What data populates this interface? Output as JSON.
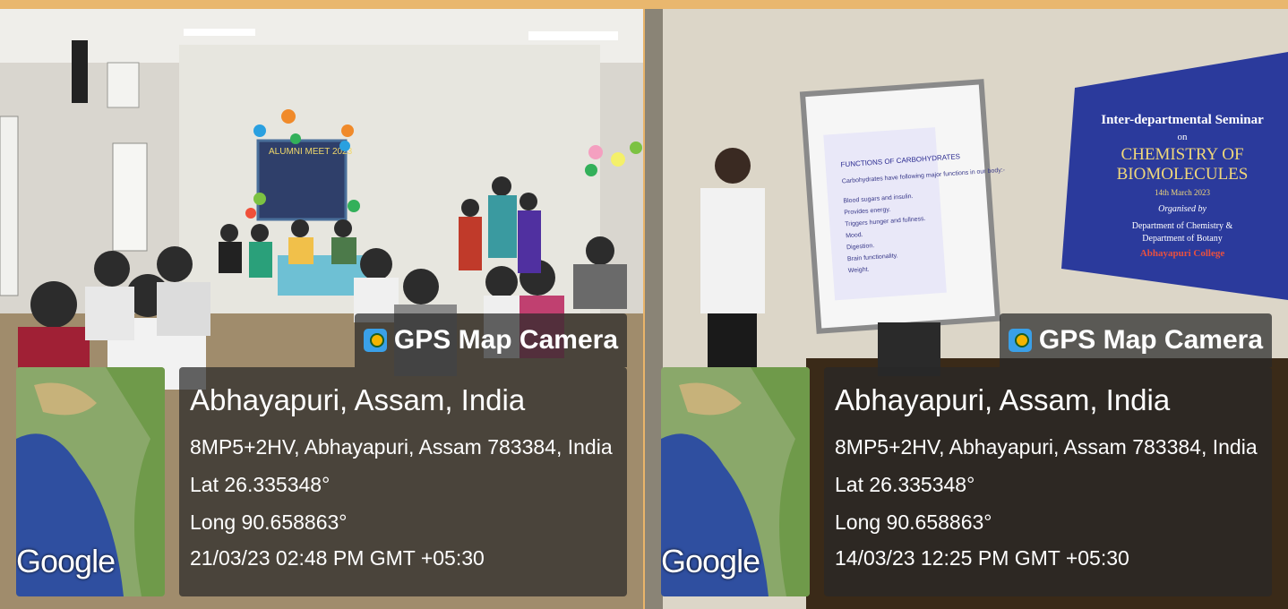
{
  "left_photo": {
    "stamp": {
      "app": "GPS Map Camera",
      "place": "Abhayapuri, Assam, India",
      "address": "8MP5+2HV, Abhayapuri, Assam 783384, India",
      "lat": "Lat 26.335348°",
      "long": "Long 90.658863°",
      "datetime": "21/03/23 02:48 PM GMT +05:30",
      "map_brand": "Google"
    },
    "banner": "ALUMNI MEET 2023"
  },
  "right_photo": {
    "stamp": {
      "app": "GPS Map Camera",
      "place": "Abhayapuri, Assam, India",
      "address": "8MP5+2HV, Abhayapuri, Assam 783384, India",
      "lat": "Lat 26.335348°",
      "long": "Long 90.658863°",
      "datetime": "14/03/23 12:25 PM GMT +05:30",
      "map_brand": "Google"
    },
    "slide": {
      "title": "FUNCTIONS OF CARBOHYDRATES",
      "lines": [
        "Carbohydrates have following major functions in our body:-",
        "Blood sugars and insulin.",
        "Provides energy.",
        "Triggers hunger and fullness.",
        "Mood.",
        "Digestion.",
        "Brain functionality.",
        "Weight."
      ]
    },
    "banner": {
      "line1": "Inter-departmental Seminar",
      "line2": "on",
      "line3": "CHEMISTRY OF",
      "line4": "BIOMOLECULES",
      "line5": "14th March 2023",
      "line6": "Organised by",
      "line7": "Department of Chemistry &",
      "line8": "Department of Botany",
      "line9": "Abhayapuri College"
    }
  },
  "colors": {
    "frame": "#e9b76e",
    "panel": "#282828",
    "banner_blue": "#2b3a9c"
  }
}
